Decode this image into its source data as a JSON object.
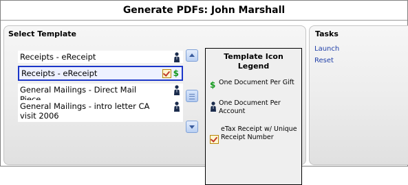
{
  "window": {
    "title": "Generate PDFs: John Marshall"
  },
  "select_template": {
    "heading": "Select Template",
    "items": [
      {
        "label": "Receipts - eReceipt",
        "icons": [
          "account-person-icon"
        ],
        "selected": false
      },
      {
        "label": "Receipts - eReceipt",
        "icons": [
          "etax-receipt-check-icon",
          "gift-dollar-icon"
        ],
        "selected": true
      },
      {
        "label": "General Mailings - Direct Mail Piece",
        "icons": [
          "account-person-icon"
        ],
        "selected": false
      },
      {
        "label": "General Mailings - intro letter CA visit 2006",
        "icons": [
          "account-person-icon"
        ],
        "selected": false
      }
    ]
  },
  "legend": {
    "title": "Template Icon Legend",
    "rows": [
      {
        "icon": "gift-dollar-icon",
        "text": "One Document Per Gift"
      },
      {
        "icon": "account-person-icon",
        "text": "One Document Per Account"
      },
      {
        "icon": "etax-receipt-check-icon",
        "text": "eTax Receipt w/ Unique Receipt Number"
      }
    ]
  },
  "tasks": {
    "heading": "Tasks",
    "links": [
      {
        "label": "Launch"
      },
      {
        "label": "Reset"
      }
    ]
  },
  "colors": {
    "selection_border": "#1b36c9",
    "link": "#1f3fa8",
    "dollar_icon": "#149a1d"
  }
}
